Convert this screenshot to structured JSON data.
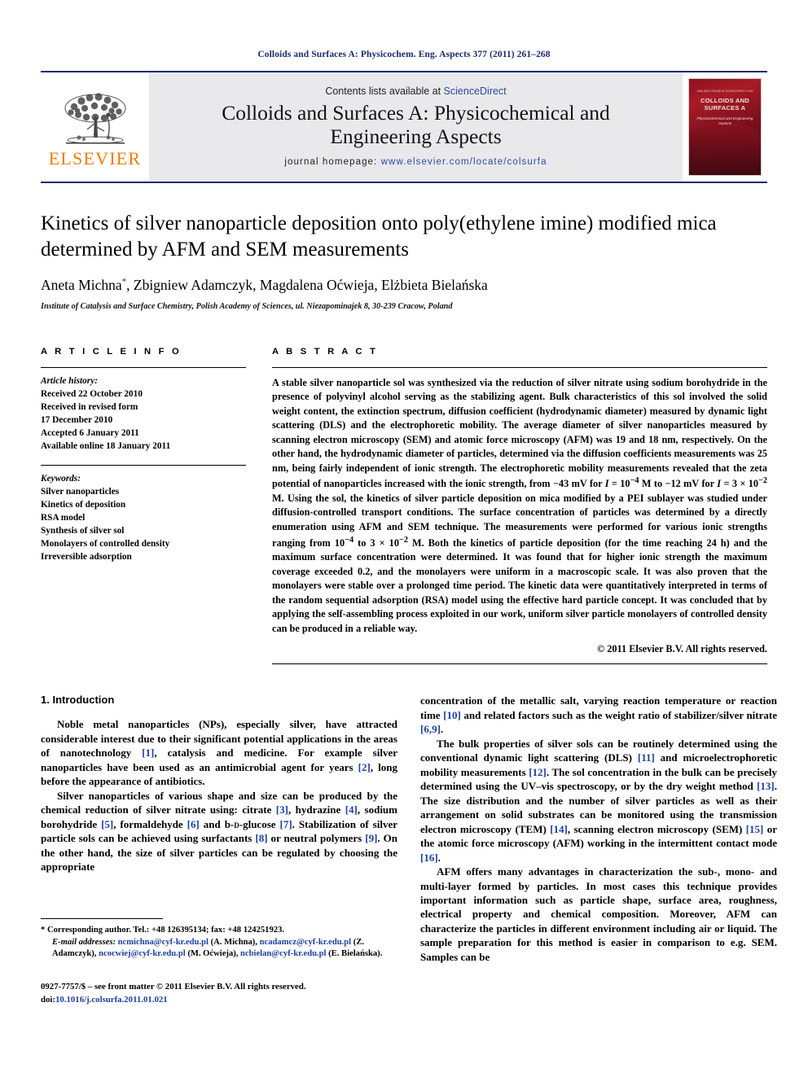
{
  "running_head": "Colloids and Surfaces A: Physicochem. Eng. Aspects 377 (2011) 261–268",
  "masthead": {
    "contents_prefix": "Contents lists available at ",
    "sciencedirect": "ScienceDirect",
    "journal_title": "Colloids and Surfaces A: Physicochemical and Engineering Aspects",
    "homepage_label": "journal homepage:",
    "homepage_url": "www.elsevier.com/locate/colsurfa",
    "publisher_wordmark": "ELSEVIER",
    "cover": {
      "top_line": "AVAILABLE ONLINE AT SCIENCEDIRECT.COM",
      "title": "COLLOIDS AND SURFACES A",
      "subtitle": "Physicochemical and Engineering Aspects"
    },
    "accent_color": "#1b2a6b",
    "link_color": "#2b4ba0",
    "elsevier_orange": "#f07c00",
    "band_color": "#e9e9eb"
  },
  "article": {
    "title": "Kinetics of silver nanoparticle deposition onto poly(ethylene imine) modified mica determined by AFM and SEM measurements",
    "authors": "Aneta Michna, Zbigniew Adamczyk, Magdalena Oćwieja, Elżbieta Bielańska",
    "author_star": "*",
    "affiliation": "Institute of Catalysis and Surface Chemistry, Polish Academy of Sciences, ul. Niezapominajek 8, 30-239 Cracow, Poland"
  },
  "article_info": {
    "heading": "A R T I C L E   I N F O",
    "history_label": "Article history:",
    "history": [
      "Received 22 October 2010",
      "Received in revised form",
      "17 December 2010",
      "Accepted 6 January 2011",
      "Available online 18 January 2011"
    ],
    "keywords_label": "Keywords:",
    "keywords": [
      "Silver nanoparticles",
      "Kinetics of deposition",
      "RSA model",
      "Synthesis of silver sol",
      "Monolayers of controlled density",
      "Irreversible adsorption"
    ]
  },
  "abstract": {
    "heading": "A B S T R A C T",
    "text": "A stable silver nanoparticle sol was synthesized via the reduction of silver nitrate using sodium borohydride in the presence of polyvinyl alcohol serving as the stabilizing agent. Bulk characteristics of this sol involved the solid weight content, the extinction spectrum, diffusion coefficient (hydrodynamic diameter) measured by dynamic light scattering (DLS) and the electrophoretic mobility. The average diameter of silver nanoparticles measured by scanning electron microscopy (SEM) and atomic force microscopy (AFM) was 19 and 18 nm, respectively. On the other hand, the hydrodynamic diameter of particles, determined via the diffusion coefficients measurements was 25 nm, being fairly independent of ionic strength. The electrophoretic mobility measurements revealed that the zeta potential of nanoparticles increased with the ionic strength, from −43 mV for I = 10−4 M to −12 mV for I = 3 × 10−2 M. Using the sol, the kinetics of silver particle deposition on mica modified by a PEI sublayer was studied under diffusion-controlled transport conditions. The surface concentration of particles was determined by a directly enumeration using AFM and SEM technique. The measurements were performed for various ionic strengths ranging from 10−4 to 3 × 10−2 M. Both the kinetics of particle deposition (for the time reaching 24 h) and the maximum surface concentration were determined. It was found that for higher ionic strength the maximum coverage exceeded 0.2, and the monolayers were uniform in a macroscopic scale. It was also proven that the monolayers were stable over a prolonged time period. The kinetic data were quantitatively interpreted in terms of the random sequential adsorption (RSA) model using the effective hard particle concept. It was concluded that by applying the self-assembling process exploited in our work, uniform silver particle monolayers of controlled density can be produced in a reliable way.",
    "copyright": "© 2011 Elsevier B.V. All rights reserved."
  },
  "body": {
    "section_number_title": "1. Introduction",
    "left_paragraphs": [
      "Noble metal nanoparticles (NPs), especially silver, have attracted considerable interest due to their significant potential applications in the areas of nanotechnology [1], catalysis and medicine. For example silver nanoparticles have been used as an antimicrobial agent for years [2], long before the appearance of antibiotics.",
      "Silver nanoparticles of various shape and size can be produced by the chemical reduction of silver nitrate using: citrate [3], hydrazine [4], sodium borohydride [5], formaldehyde [6] and b-D-glucose [7]. Stabilization of silver particle sols can be achieved using surfactants [8] or neutral polymers [9]. On the other hand, the size of silver particles can be regulated by choosing the appropriate"
    ],
    "right_paragraphs": [
      "concentration of the metallic salt, varying reaction temperature or reaction time [10] and related factors such as the weight ratio of stabilizer/silver nitrate [6,9].",
      "The bulk properties of silver sols can be routinely determined using the conventional dynamic light scattering (DLS) [11] and microelectrophoretic mobility measurements [12]. The sol concentration in the bulk can be precisely determined using the UV–vis spectroscopy, or by the dry weight method [13]. The size distribution and the number of silver particles as well as their arrangement on solid substrates can be monitored using the transmission electron microscopy (TEM) [14], scanning electron microscopy (SEM) [15] or the atomic force microscopy (AFM) working in the intermittent contact mode [16].",
      "AFM offers many advantages in characterization the sub-, mono- and multi-layer formed by particles. In most cases this technique provides important information such as particle shape, surface area, roughness, electrical property and chemical composition. Moreover, AFM can characterize the particles in different environment including air or liquid. The sample preparation for this method is easier in comparison to e.g. SEM. Samples can be"
    ],
    "reference_link_color": "#1e3f9e"
  },
  "footnotes": {
    "corresponding": "* Corresponding author. Tel.: +48 126395134; fax: +48 124251923.",
    "email_label": "E-mail addresses:",
    "emails": [
      {
        "address": "ncmichna@cyf-kr.edu.pl",
        "name": "(A. Michna),"
      },
      {
        "address": "ncadamcz@cyf-kr.edu.pl",
        "name": "(Z. Adamczyk),"
      },
      {
        "address": "ncocwiej@cyf-kr.edu.pl",
        "name": "(M. Oćwieja),"
      },
      {
        "address": "ncbielan@cyf-kr.edu.pl",
        "name": "(E. Bielańska)."
      }
    ]
  },
  "footer": {
    "issn_line": "0927-7757/$ – see front matter © 2011 Elsevier B.V. All rights reserved.",
    "doi_label": "doi:",
    "doi_value": "10.1016/j.colsurfa.2011.01.021"
  }
}
